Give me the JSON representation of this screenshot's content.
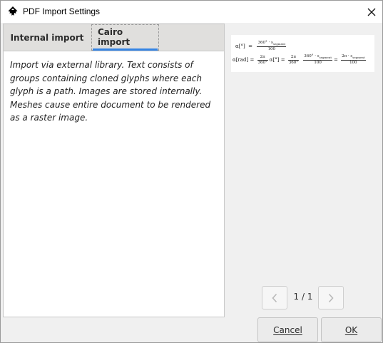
{
  "window": {
    "title": "PDF Import Settings",
    "icons": {
      "app": "inkscape-icon",
      "close": "close-icon"
    }
  },
  "tabs": [
    {
      "label": "Internal import",
      "selected": false
    },
    {
      "label": "Cairo import",
      "selected": true
    }
  ],
  "description": "Import via external library. Text consists of groups containing cloned glyphs where each glyph is a path. Images are stored internally. Meshes cause entire document to be rendered as a raster image.",
  "preview": {
    "row1": {
      "lhs": "α[°]",
      "eq": "=",
      "num": "360° · s",
      "sub": "segment",
      "den": "100"
    },
    "row2": {
      "lhs": "α[rad]",
      "eq": "=",
      "f1_num": "2π",
      "f1_den": "360°",
      "mid": "α[°] =",
      "f2_num": "2π",
      "f2_den": "360°",
      "f3_num": "360° · s",
      "f3_sub": "segment",
      "f3_den": "100",
      "eq2": "=",
      "f4_num": "2π · s",
      "f4_sub": "segment",
      "f4_den": "100"
    }
  },
  "pager": {
    "label": "1 / 1",
    "icons": {
      "prev": "chevron-left-icon",
      "next": "chevron-right-icon"
    }
  },
  "buttons": {
    "cancel": "Cancel",
    "ok": "OK"
  },
  "colors": {
    "accent": "#3584e4",
    "window_bg": "#f0f0f0",
    "tabbar_bg": "#e0dfdd"
  }
}
